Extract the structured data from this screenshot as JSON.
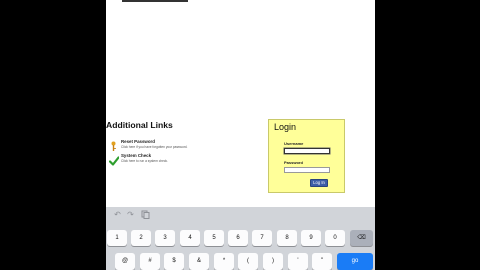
{
  "page": {
    "additional_links": {
      "heading": "Additional Links",
      "items": [
        {
          "icon": "key-icon",
          "title": "Reset Password",
          "desc": "Click here if you have forgotten your password."
        },
        {
          "icon": "checkmark-icon",
          "title": "System Check",
          "desc": "Click here to run a system check."
        }
      ]
    },
    "login": {
      "title": "Login",
      "username_label": "Username",
      "username_value": "",
      "password_label": "Password",
      "password_value": "",
      "button_label": "Log In"
    }
  },
  "keyboard": {
    "toolbar": [
      "undo-icon",
      "redo-icon",
      "paste-icon"
    ],
    "row1": [
      "1",
      "2",
      "3",
      "4",
      "5",
      "6",
      "7",
      "8",
      "9",
      "0"
    ],
    "row1_delete": "⌫",
    "row2": [
      "@",
      "#",
      "$",
      "&",
      "*",
      "(",
      ")",
      "'",
      "\""
    ],
    "row2_action": "go"
  },
  "colors": {
    "login_bg": "#ffff99",
    "go_key": "#1a7cf6",
    "login_button": "#3d5ea8"
  }
}
